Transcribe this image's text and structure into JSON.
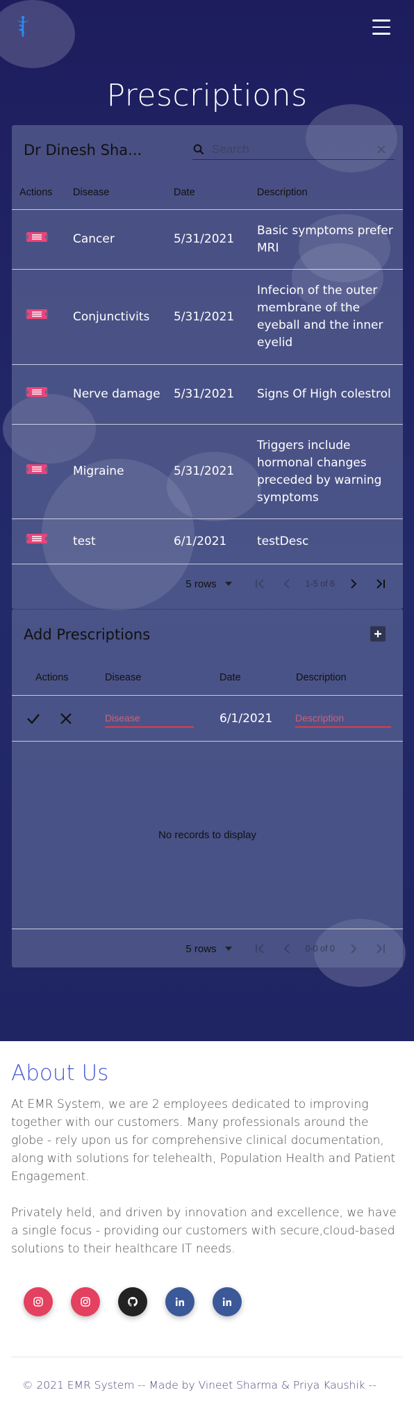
{
  "app": {
    "title": "Prescriptions",
    "logo_icon": "caduceus-icon",
    "menu_icon": "hamburger-menu-icon"
  },
  "prescriptions": {
    "toolbar_title": "Dr Dinesh Sha...",
    "search_placeholder": "Search",
    "columns": [
      "Actions",
      "Disease",
      "Date",
      "Description"
    ],
    "rows": [
      {
        "disease": "Cancer",
        "date": "5/31/2021",
        "description": "Basic symptoms prefer MRI"
      },
      {
        "disease": "Conjunctivits",
        "date": "5/31/2021",
        "description": "Infecion of the outer membrane of the eyeball and the inner eyelid"
      },
      {
        "disease": "Nerve damage",
        "date": "5/31/2021",
        "description": "Signs Of High colestrol"
      },
      {
        "disease": "Migraine",
        "date": "5/31/2021",
        "description": "Triggers include hormonal changes preceded by warning symptoms"
      },
      {
        "disease": "test",
        "date": "6/1/2021",
        "description": "testDesc"
      }
    ],
    "pagination": {
      "rows_label": "5 rows",
      "count": "1-5 of 6"
    }
  },
  "add": {
    "title": "Add Prescriptions",
    "columns": [
      "Actions",
      "Disease",
      "Date",
      "Description"
    ],
    "disease_placeholder": "Disease",
    "date_value": "6/1/2021",
    "description_placeholder": "Description",
    "empty_text": "No records to display",
    "pagination": {
      "rows_label": "5 rows",
      "count": "0-0 of 0"
    }
  },
  "about": {
    "heading": "About Us",
    "para1": "At EMR System, we are 2 employees dedicated to improving together with our customers. Many professionals around the globe - rely upon us for comprehensive clinical documentation, along with solutions for telehealth, Population Health and Patient Engagement.",
    "para2": "Privately held, and driven by innovation and excellence, we have a single focus - providing our customers with secure,cloud-based solutions to their healthcare IT needs.",
    "social": [
      {
        "icon": "instagram-icon",
        "color": "#e4405f"
      },
      {
        "icon": "instagram-icon",
        "color": "#e4405f"
      },
      {
        "icon": "github-icon",
        "color": "#222222"
      },
      {
        "icon": "linkedin-icon",
        "color": "#3b5998"
      },
      {
        "icon": "linkedin-icon",
        "color": "#3b5998"
      }
    ]
  },
  "footer": {
    "text": "© 2021 EMR System -- Made by Vineet Sharma & Priya Kaushik --"
  },
  "colors": {
    "hero_bg": "#1f2463",
    "accent_pink": "#e8457a",
    "about_heading": "#4b5bd0",
    "input_underline": "#e53947"
  }
}
